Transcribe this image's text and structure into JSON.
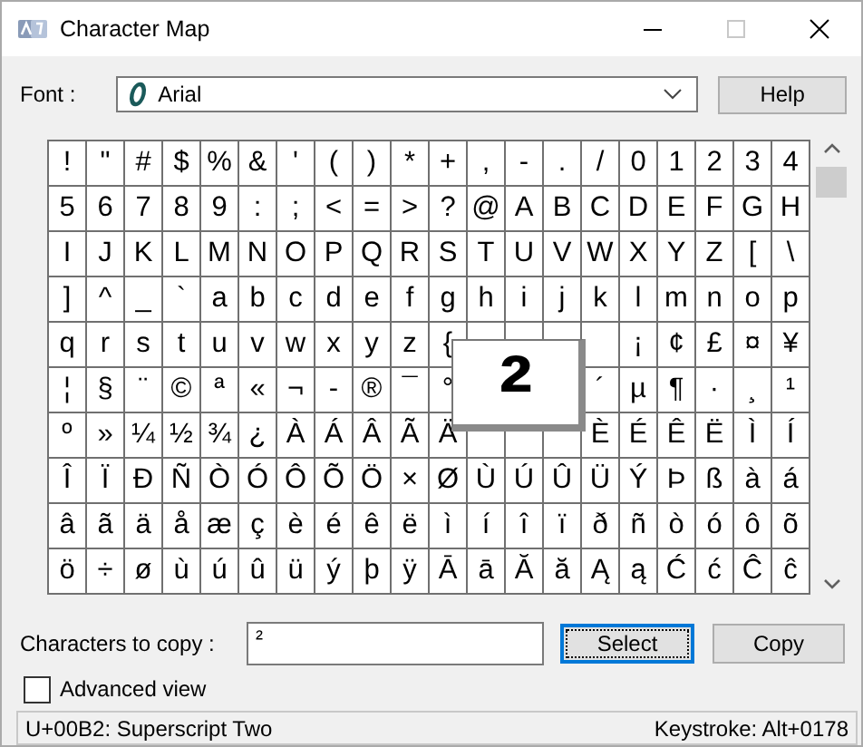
{
  "window": {
    "title": "Character Map"
  },
  "font": {
    "label": "Font :",
    "value": "Arial",
    "button": "Help"
  },
  "grid": {
    "rows": [
      [
        "!",
        "\"",
        "#",
        "$",
        "%",
        "&",
        "'",
        "(",
        ")",
        "*",
        "+",
        ",",
        "-",
        ".",
        "/",
        "0",
        "1",
        "2",
        "3",
        "4"
      ],
      [
        "5",
        "6",
        "7",
        "8",
        "9",
        ":",
        ";",
        "<",
        "=",
        ">",
        "?",
        "@",
        "A",
        "B",
        "C",
        "D",
        "E",
        "F",
        "G",
        "H"
      ],
      [
        "I",
        "J",
        "K",
        "L",
        "M",
        "N",
        "O",
        "P",
        "Q",
        "R",
        "S",
        "T",
        "U",
        "V",
        "W",
        "X",
        "Y",
        "Z",
        "[",
        "\\"
      ],
      [
        "]",
        "^",
        "_",
        "`",
        "a",
        "b",
        "c",
        "d",
        "e",
        "f",
        "g",
        "h",
        "i",
        "j",
        "k",
        "l",
        "m",
        "n",
        "o",
        "p"
      ],
      [
        "q",
        "r",
        "s",
        "t",
        "u",
        "v",
        "w",
        "x",
        "y",
        "z",
        "{",
        null,
        null,
        null,
        null,
        "¡",
        "¢",
        "£",
        "¤",
        "¥"
      ],
      [
        "¦",
        "§",
        "¨",
        "©",
        "ª",
        "«",
        "¬",
        "-",
        "®",
        "¯",
        "°",
        null,
        null,
        null,
        "´",
        "µ",
        "¶",
        "·",
        "¸",
        "¹"
      ],
      [
        "º",
        "»",
        "¼",
        "½",
        "¾",
        "¿",
        "À",
        "Á",
        "Â",
        "Ã",
        "Ä",
        null,
        null,
        null,
        "È",
        "É",
        "Ê",
        "Ë",
        "Ì",
        "Í"
      ],
      [
        "Î",
        "Ï",
        "Ð",
        "Ñ",
        "Ò",
        "Ó",
        "Ô",
        "Õ",
        "Ö",
        "×",
        "Ø",
        "Ù",
        "Ú",
        "Û",
        "Ü",
        "Ý",
        "Þ",
        "ß",
        "à",
        "á"
      ],
      [
        "â",
        "ã",
        "ä",
        "å",
        "æ",
        "ç",
        "è",
        "é",
        "ê",
        "ë",
        "ì",
        "í",
        "î",
        "ï",
        "ð",
        "ñ",
        "ò",
        "ó",
        "ô",
        "õ"
      ],
      [
        "ö",
        "÷",
        "ø",
        "ù",
        "ú",
        "û",
        "ü",
        "ý",
        "þ",
        "ÿ",
        "Ā",
        "ā",
        "Ă",
        "ă",
        "Ą",
        "ą",
        "Ć",
        "ć",
        "Ĉ",
        "ĉ"
      ]
    ],
    "magnified": "²"
  },
  "copy": {
    "label": "Characters to copy :",
    "value": "²",
    "buttons": [
      {
        "label": "Select",
        "focused": true
      },
      {
        "label": "Copy",
        "focused": false
      }
    ]
  },
  "advanced_view": {
    "label": "Advanced view",
    "checked": false
  },
  "status_bar": {
    "character": "U+00B2: Superscript Two",
    "keystroke": "Keystroke: Alt+0178"
  }
}
